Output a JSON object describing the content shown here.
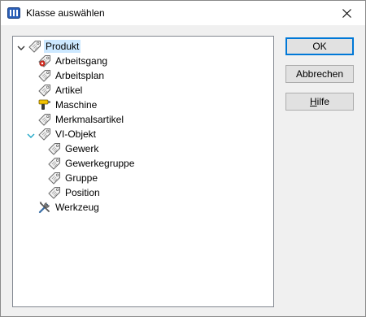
{
  "window": {
    "title": "Klasse auswählen"
  },
  "tree": {
    "root": {
      "label": "Produkt",
      "icon": "tag-icon",
      "expanded": true,
      "selected": true
    },
    "items": [
      {
        "label": "Arbeitsgang",
        "icon": "gear-tag-icon"
      },
      {
        "label": "Arbeitsplan",
        "icon": "tag-icon"
      },
      {
        "label": "Artikel",
        "icon": "tag-icon"
      },
      {
        "label": "Maschine",
        "icon": "drill-icon"
      },
      {
        "label": "Merkmalsartikel",
        "icon": "tag-icon"
      },
      {
        "label": "VI-Objekt",
        "icon": "tag-icon",
        "expanded": true,
        "children": [
          {
            "label": "Gewerk",
            "icon": "tag-icon"
          },
          {
            "label": "Gewerkegruppe",
            "icon": "tag-icon"
          },
          {
            "label": "Gruppe",
            "icon": "tag-icon"
          },
          {
            "label": "Position",
            "icon": "tag-icon"
          }
        ]
      },
      {
        "label": "Werkzeug",
        "icon": "tools-icon"
      }
    ]
  },
  "buttons": {
    "ok": "OK",
    "cancel": "Abbrechen",
    "help_first": "H",
    "help_rest": "ilfe"
  },
  "colors": {
    "selection": "#cce8ff",
    "default_button_border": "#0078d7",
    "expander_expanded_teal": "#1fa7c7"
  }
}
